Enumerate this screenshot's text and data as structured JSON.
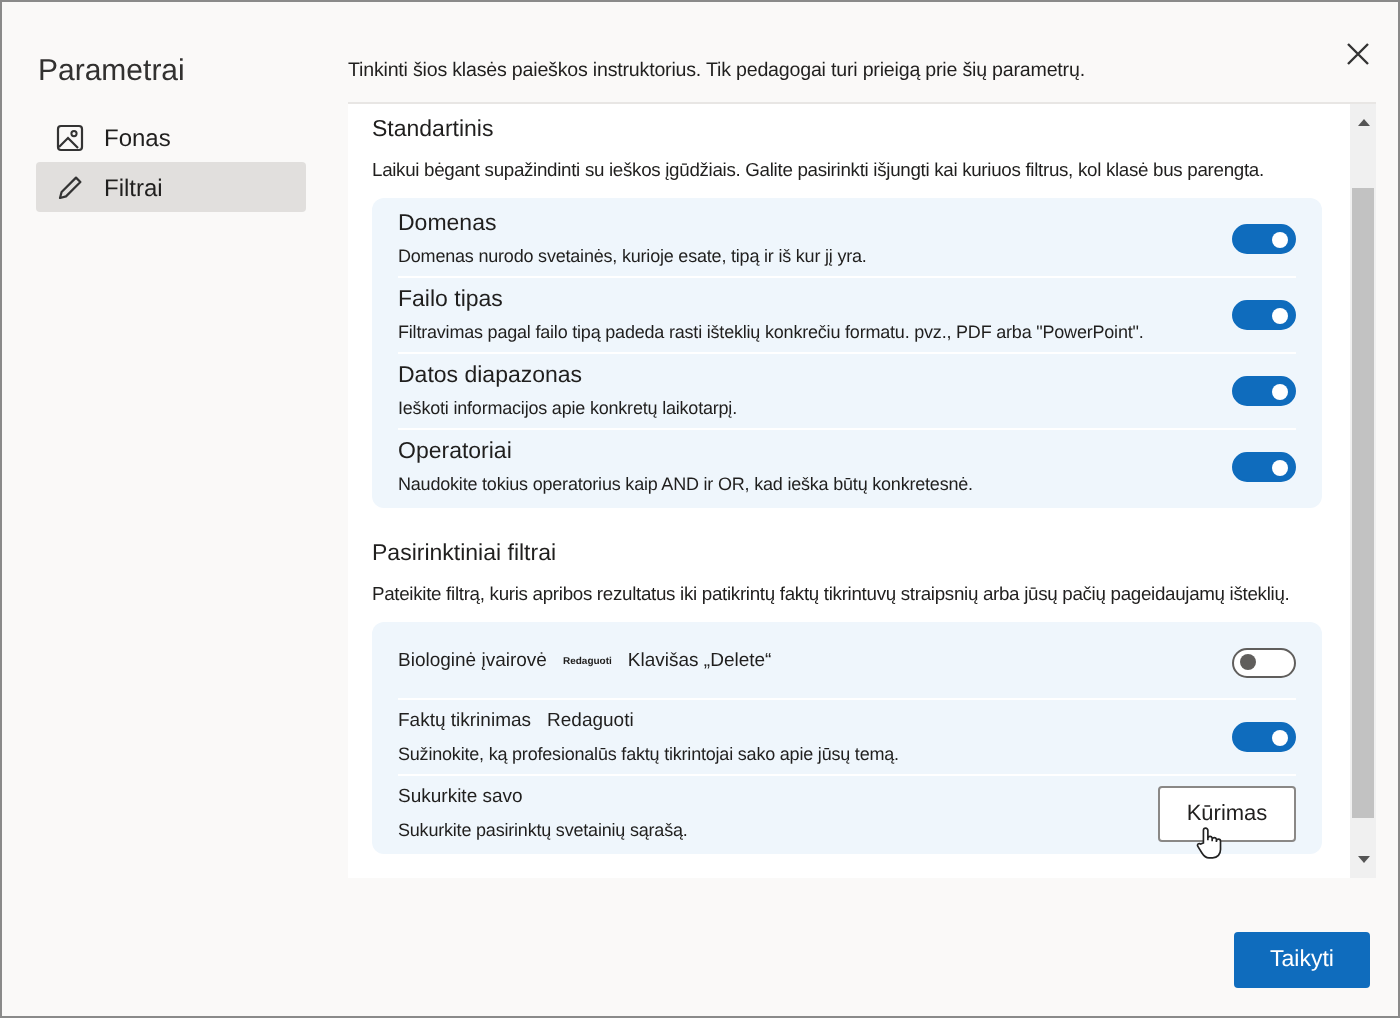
{
  "sidebar": {
    "title": "Parametrai",
    "items": [
      {
        "label": "Fonas",
        "selected": false
      },
      {
        "label": "Filtrai",
        "selected": true
      }
    ]
  },
  "intro": "Tinkinti šios klasės paieškos instruktorius. Tik pedagogai turi prieigą prie šių parametrų.",
  "sections": [
    {
      "title": "Standartinis",
      "description": "Laikui bėgant supažindinti su ieškos įgūdžiais. Galite pasirinkti išjungti kai kuriuos filtrus, kol klasė bus parengta.",
      "filters": [
        {
          "kind": "toggle",
          "name": "Domenas",
          "description": "Domenas nurodo svetainės, kurioje esate, tipą ir iš kur jį yra.",
          "on": true
        },
        {
          "kind": "toggle",
          "name": "Failo tipas",
          "description": "Filtravimas pagal failo tipą padeda rasti išteklių konkrečiu formatu. pvz., PDF arba \"PowerPoint\".",
          "on": true
        },
        {
          "kind": "toggle",
          "name": "Datos diapazonas",
          "description": "Ieškoti informacijos apie konkretų laikotarpį.",
          "on": true
        },
        {
          "kind": "toggle",
          "name": "Operatoriai",
          "description": "Naudokite tokius operatorius kaip AND ir OR, kad ieška būtų konkretesnė.",
          "on": true
        }
      ]
    },
    {
      "title": "Pasirinktiniai filtrai",
      "description": "Pateikite filtrą, kuris apribos rezultatus iki patikrintų faktų tikrintuvų straipsnių arba jūsų pačių pageidaujamų išteklių.",
      "filters": [
        {
          "kind": "toggle",
          "name": "Biologinė įvairovė",
          "small_tag": "Redaguoti",
          "tag": "Klavišas „Delete“",
          "on": false
        },
        {
          "kind": "toggle",
          "name": "Faktų tikrinimas",
          "tag": "Redaguoti",
          "description": "Sužinokite, ką profesionalūs faktų tikrintojai sako apie jūsų temą.",
          "on": true
        },
        {
          "kind": "button",
          "name": "Sukurkite savo",
          "description": "Sukurkite pasirinktų svetainių sąrašą.",
          "button": "Kūrimas"
        }
      ]
    }
  ],
  "apply_button": "Taikyti"
}
